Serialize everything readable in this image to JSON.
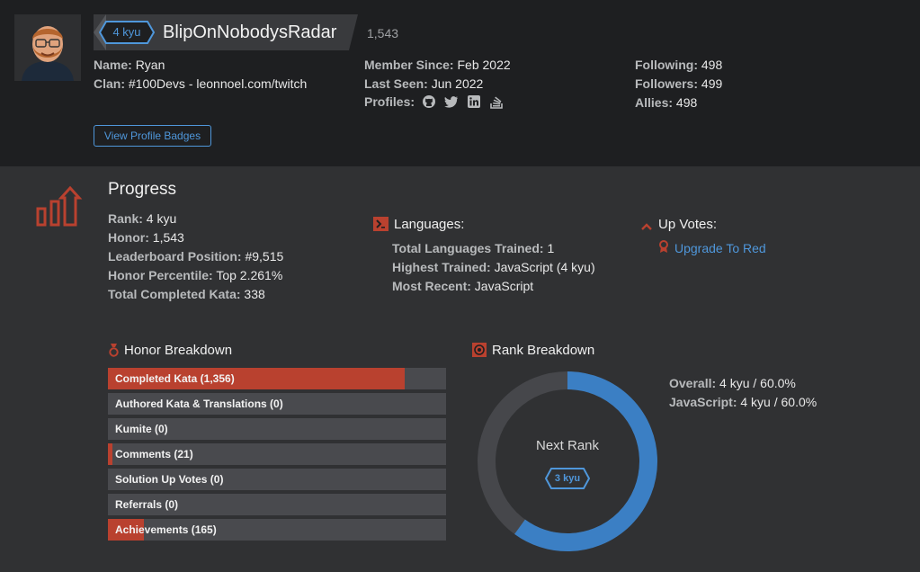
{
  "header": {
    "rank_badge": "4 kyu",
    "username": "BlipOnNobodysRadar",
    "honor": "1,543",
    "name_label": "Name:",
    "name_value": "Ryan",
    "clan_label": "Clan:",
    "clan_value": "#100Devs - leonnoel.com/twitch",
    "member_since_label": "Member Since:",
    "member_since_value": "Feb 2022",
    "last_seen_label": "Last Seen:",
    "last_seen_value": "Jun 2022",
    "profiles_label": "Profiles:",
    "profile_icons": [
      "github-icon",
      "twitter-icon",
      "linkedin-icon",
      "stackoverflow-icon"
    ],
    "following_label": "Following:",
    "following_value": "498",
    "followers_label": "Followers:",
    "followers_value": "499",
    "allies_label": "Allies:",
    "allies_value": "498",
    "badges_button": "View Profile Badges"
  },
  "progress": {
    "title": "Progress",
    "rank_label": "Rank:",
    "rank_value": "4 kyu",
    "honor_label": "Honor:",
    "honor_value": "1,543",
    "leaderboard_label": "Leaderboard Position:",
    "leaderboard_value": "#9,515",
    "percentile_label": "Honor Percentile:",
    "percentile_value": "Top 2.261%",
    "kata_label": "Total Completed Kata:",
    "kata_value": "338"
  },
  "languages": {
    "title": "Languages:",
    "trained_label": "Total Languages Trained:",
    "trained_value": "1",
    "highest_label": "Highest Trained:",
    "highest_value": "JavaScript (4 kyu)",
    "recent_label": "Most Recent:",
    "recent_value": "JavaScript"
  },
  "upvotes": {
    "title": "Up Votes:",
    "link": "Upgrade To Red"
  },
  "honor_breakdown": {
    "title": "Honor Breakdown",
    "bars": [
      {
        "label": "Completed Kata (1,356)",
        "fraction": 0.878
      },
      {
        "label": "Authored Kata & Translations (0)",
        "fraction": 0
      },
      {
        "label": "Kumite (0)",
        "fraction": 0
      },
      {
        "label": "Comments (21)",
        "fraction": 0.014
      },
      {
        "label": "Solution Up Votes (0)",
        "fraction": 0
      },
      {
        "label": "Referrals (0)",
        "fraction": 0
      },
      {
        "label": "Achievements (165)",
        "fraction": 0.107
      }
    ]
  },
  "rank_breakdown": {
    "title": "Rank Breakdown",
    "overall_label": "Overall:",
    "overall_value": "4 kyu / 60.0%",
    "js_label": "JavaScript:",
    "js_value": "4 kyu / 60.0%",
    "next_rank_label": "Next Rank",
    "next_rank_badge": "3 kyu",
    "progress_fraction": 0.6
  },
  "colors": {
    "accent_blue": "#4f97db",
    "accent_red": "#b9412f",
    "bar_bg": "#494a4e",
    "header_bg": "#1e1f21",
    "page_bg": "#303133"
  }
}
